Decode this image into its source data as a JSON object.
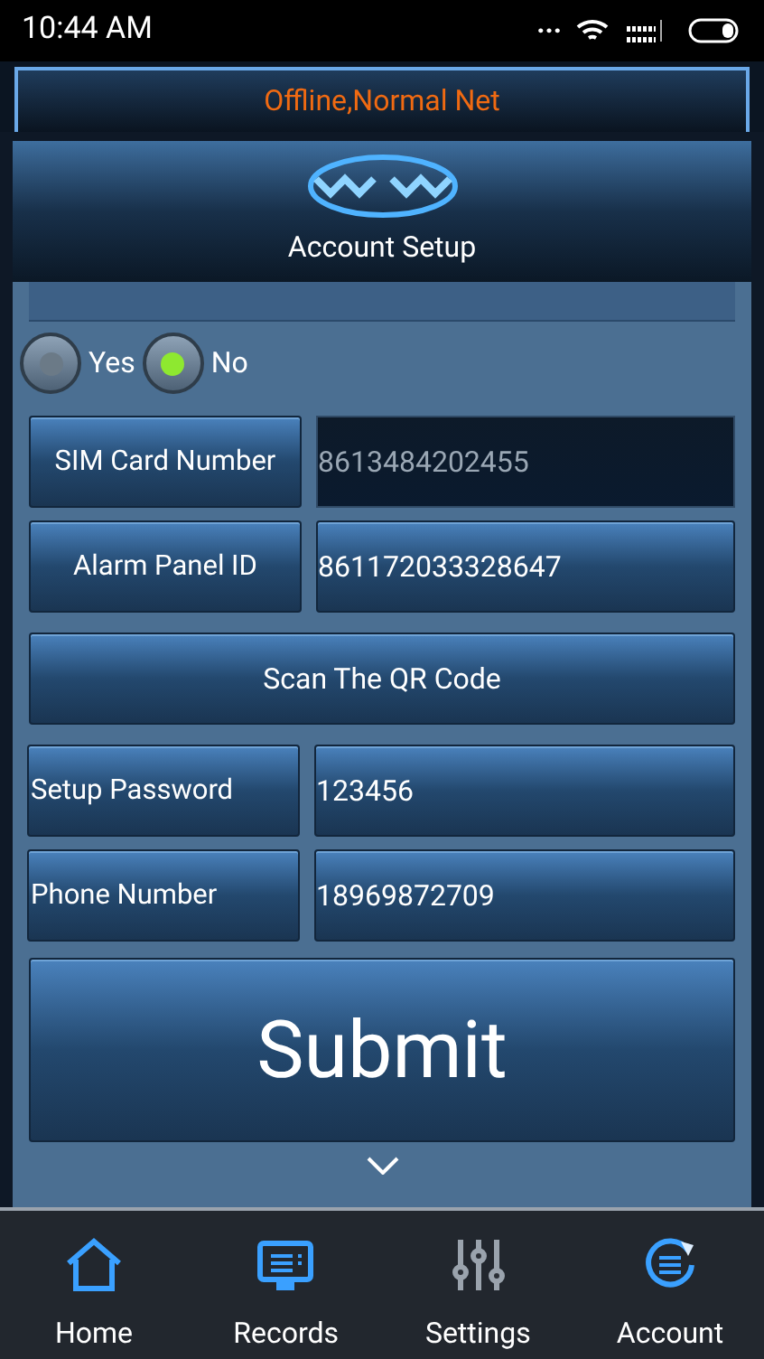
{
  "status_bar": {
    "time": "10:44 AM",
    "dots": "..."
  },
  "connection_banner": "Offline,Normal Net",
  "header": {
    "title": "Account Setup"
  },
  "radio_options": [
    {
      "label": "Yes",
      "selected": false
    },
    {
      "label": "No",
      "selected": true
    }
  ],
  "form_rows": [
    {
      "kind": "field",
      "label": "SIM Card Number",
      "value": "8613484202455",
      "disabled": true
    },
    {
      "kind": "field",
      "label": "Alarm Panel ID",
      "value": "861172033328647",
      "disabled": false
    },
    {
      "kind": "button",
      "label": "Scan The QR Code"
    },
    {
      "kind": "field",
      "label": "Setup Password",
      "value": "123456",
      "disabled": false
    },
    {
      "kind": "field",
      "label": "Phone Number",
      "value": "18969872709",
      "disabled": false
    }
  ],
  "submit_button": "Submit",
  "nav_items": [
    {
      "label": "Home"
    },
    {
      "label": "Records"
    },
    {
      "label": "Settings"
    },
    {
      "label": "Account"
    }
  ]
}
